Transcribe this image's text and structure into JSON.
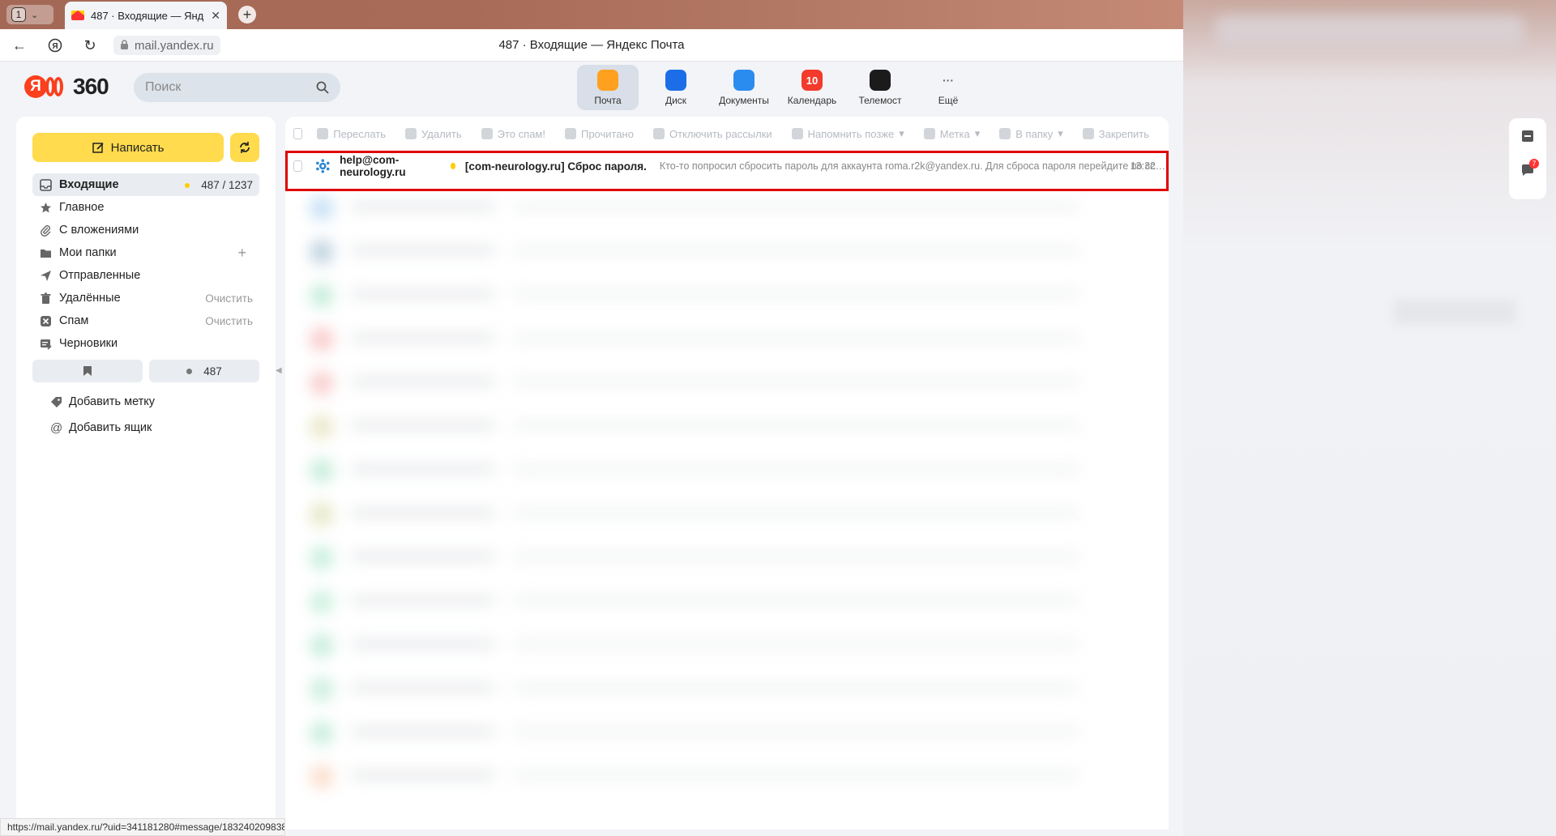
{
  "browser": {
    "tab_count": "1",
    "tab_title": "487 · Входящие — Яндекс Почта",
    "url": "mail.yandex.ru",
    "page_title": "487 · Входящие — Яндекс Почта",
    "status_url": "https://mail.yandex.ru/?uid=341181280#message/183240209838"
  },
  "header": {
    "logo_letter": "Я",
    "logo_text": "360",
    "search_placeholder": "Поиск",
    "services": [
      {
        "label": "Почта",
        "icon": "mail-icon",
        "color": "#ffa01e"
      },
      {
        "label": "Диск",
        "icon": "disk-icon",
        "color": "#1c6ee8"
      },
      {
        "label": "Документы",
        "icon": "docs-icon",
        "color": "#2b8cf0"
      },
      {
        "label": "Календарь",
        "icon": "calendar-icon",
        "color": "#f33a2c",
        "badge": "10"
      },
      {
        "label": "Телемост",
        "icon": "telemost-icon",
        "color": "#1b1b1b"
      },
      {
        "label": "Ещё",
        "icon": "more-icon",
        "color": "transparent",
        "glyph": "···"
      }
    ]
  },
  "sidebar": {
    "compose_label": "Написать",
    "folders": [
      {
        "label": "Входящие",
        "icon": "inbox-icon",
        "right": "487 / 1237"
      },
      {
        "label": "Главное",
        "icon": "star-icon",
        "right": ""
      },
      {
        "label": "С вложениями",
        "icon": "paperclip-icon",
        "right": ""
      },
      {
        "label": "Мои папки",
        "icon": "folder-icon",
        "right": "+"
      },
      {
        "label": "Отправленные",
        "icon": "send-icon",
        "right": ""
      },
      {
        "label": "Удалённые",
        "icon": "trash-icon",
        "right": "Очистить"
      },
      {
        "label": "Спам",
        "icon": "spam-icon",
        "right": "Очистить"
      },
      {
        "label": "Черновики",
        "icon": "drafts-icon",
        "right": ""
      }
    ],
    "unread_pill": "487",
    "add_label": "Добавить метку",
    "add_mailbox": "Добавить ящик"
  },
  "toolbar": {
    "items": [
      "Переслать",
      "Удалить",
      "Это спам!",
      "Прочитано",
      "Отключить рассылки",
      "Напомнить позже",
      "Метка",
      "В папку",
      "Закрепить"
    ]
  },
  "message": {
    "from": "help@com-neurology.ru",
    "subject": "[com-neurology.ru] Сброс пароля.",
    "snippet": "Кто-то попросил сбросить пароль для аккаунта roma.r2k@yandex.ru. Для сброса пароля перейдите по ссылке ниже: http://com-neurology.ru/pro...",
    "time": "13:32"
  },
  "right_rail": {
    "chat_badge": "7"
  },
  "colors": {
    "accent_yellow": "#ffdb4d",
    "highlight_red": "#e00000",
    "yandex_red": "#fc3f1d"
  }
}
